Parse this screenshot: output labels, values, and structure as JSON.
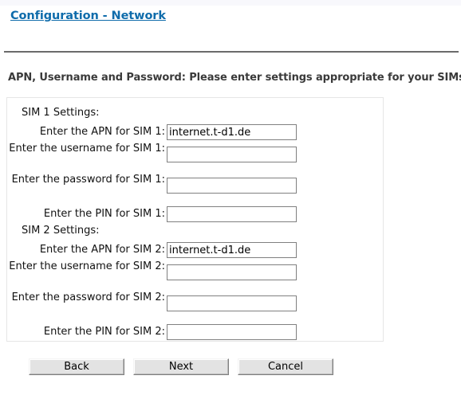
{
  "page": {
    "title_link": "Configuration - Network",
    "instruction": "APN, Username and Password: Please enter settings appropriate for your SIMs:"
  },
  "colors": {
    "link": "#0f6cab",
    "divider": "#6b6b6b",
    "panel_border": "#e6e6e6",
    "input_border": "#808080",
    "button_face": "#e3e3e3",
    "top_strip": "#f8f8fc"
  },
  "sim1": {
    "group_label": "SIM 1 Settings:",
    "fields": [
      {
        "label": "Enter the APN for SIM 1:",
        "value": "internet.t-d1.de",
        "placeholder": "",
        "two_line": false
      },
      {
        "label": "Enter the username for SIM 1:",
        "value": "",
        "placeholder": "",
        "two_line": true
      },
      {
        "label": "Enter the password for SIM 1:",
        "value": "",
        "placeholder": "",
        "two_line": true
      },
      {
        "label": "Enter the PIN for SIM 1:",
        "value": "",
        "placeholder": "",
        "two_line": false
      }
    ]
  },
  "sim2": {
    "group_label": "SIM 2 Settings:",
    "fields": [
      {
        "label": "Enter the APN for SIM 2:",
        "value": "internet.t-d1.de",
        "placeholder": "",
        "two_line": false
      },
      {
        "label": "Enter the username for SIM 2:",
        "value": "",
        "placeholder": "",
        "two_line": true
      },
      {
        "label": "Enter the password for SIM 2:",
        "value": "",
        "placeholder": "",
        "two_line": true
      },
      {
        "label": "Enter the PIN for SIM 2:",
        "value": "",
        "placeholder": "",
        "two_line": false
      }
    ]
  },
  "buttons": {
    "back": "Back",
    "next": "Next",
    "cancel": "Cancel"
  }
}
